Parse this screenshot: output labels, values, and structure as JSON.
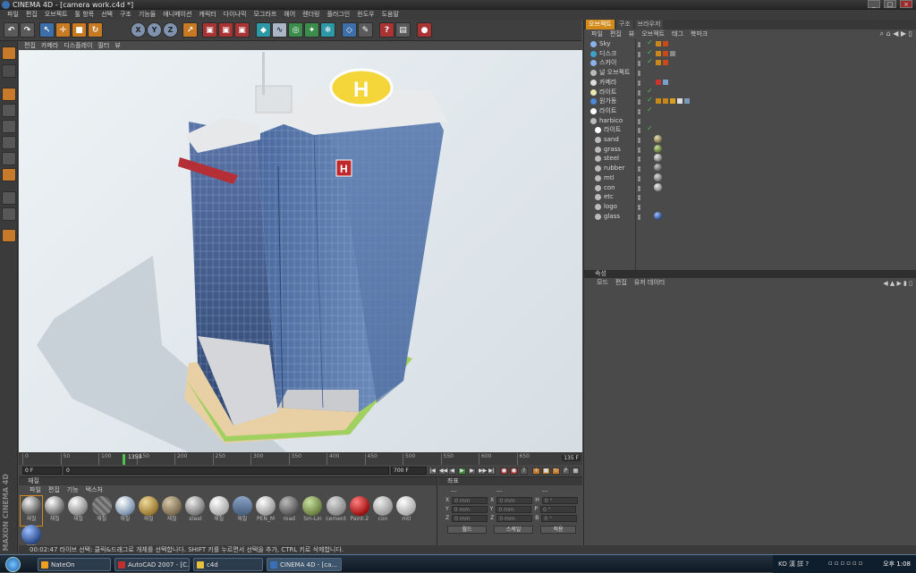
{
  "window": {
    "title": "CINEMA 4D - [camera work.c4d *]",
    "controls": [
      "_",
      "□",
      "×"
    ]
  },
  "menubar": [
    "파일",
    "편집",
    "오브젝트",
    "툴 항목",
    "선택",
    "구조",
    "기능들",
    "애니메이션",
    "캐릭터",
    "다이나믹",
    "모그라프",
    "헤어",
    "렌더링",
    "플러그인",
    "윈도우",
    "도움말"
  ],
  "toolbar": {
    "tools": [
      {
        "name": "undo",
        "glyph": "↶",
        "tone": ""
      },
      {
        "name": "redo",
        "glyph": "↷",
        "tone": ""
      },
      {
        "name": "live-select",
        "glyph": "↖",
        "tone": "b"
      },
      {
        "name": "move",
        "glyph": "✛",
        "tone": "o"
      },
      {
        "name": "scale",
        "glyph": "■",
        "tone": "o"
      },
      {
        "name": "rotate",
        "glyph": "↻",
        "tone": "o"
      },
      {
        "name": "x-axis",
        "glyph": "X",
        "tone": "ring"
      },
      {
        "name": "y-axis",
        "glyph": "Y",
        "tone": "ring"
      },
      {
        "name": "z-axis",
        "glyph": "Z",
        "tone": "ring"
      },
      {
        "name": "coord-system",
        "glyph": "↗",
        "tone": "o"
      },
      {
        "name": "render-view",
        "glyph": "▣",
        "tone": "r"
      },
      {
        "name": "render-picture-viewer",
        "glyph": "▣",
        "tone": "r"
      },
      {
        "name": "render-settings",
        "glyph": "▣",
        "tone": "r"
      },
      {
        "name": "cube",
        "glyph": "◆",
        "tone": "c"
      },
      {
        "name": "spline",
        "glyph": "∿",
        "tone": "l"
      },
      {
        "name": "nurbs",
        "glyph": "◎",
        "tone": "g"
      },
      {
        "name": "array",
        "glyph": "✦",
        "tone": "g"
      },
      {
        "name": "deformer",
        "glyph": "❄",
        "tone": "c"
      },
      {
        "name": "scene",
        "glyph": "◇",
        "tone": "b"
      },
      {
        "name": "camera",
        "glyph": "✎",
        "tone": ""
      },
      {
        "name": "light",
        "glyph": "?",
        "tone": "r"
      },
      {
        "name": "render-region",
        "glyph": "▤",
        "tone": ""
      },
      {
        "name": "record",
        "glyph": "●",
        "tone": "r"
      }
    ]
  },
  "viewport": {
    "menu": [
      "편집",
      "카메라",
      "디스플레이",
      "필터",
      "뷰"
    ],
    "sign_letter": "H"
  },
  "timeline": {
    "ticks": [
      "0",
      "50",
      "100",
      "150",
      "200",
      "250",
      "300",
      "350",
      "400",
      "450",
      "500",
      "550",
      "600",
      "650"
    ],
    "playhead_label": "1350",
    "end_frame": "135 F"
  },
  "transport": {
    "start": "0 F",
    "current": "0",
    "end": "700 F"
  },
  "materials": {
    "title": "재질",
    "menu": [
      "파일",
      "편집",
      "기능",
      "텍스처"
    ],
    "items": [
      {
        "label": "재질",
        "color": "radial-gradient(circle at 35% 30%,#f0f0f0,#555 70%,#222)",
        "selected": true
      },
      {
        "label": "재질",
        "color": "radial-gradient(circle at 35% 30%,#fff,#666 70%,#333)"
      },
      {
        "label": "재질",
        "color": "radial-gradient(circle at 35% 30%,#fff,#888 70%,#444)"
      },
      {
        "label": "재질",
        "color": "repeating-linear-gradient(45deg,#666 0 3px,#888 3px 6px)"
      },
      {
        "label": "재질",
        "color": "radial-gradient(circle at 35% 30%,#fff,#8aa0b8 60%,#3b4e66)"
      },
      {
        "label": "재질",
        "color": "radial-gradient(circle at 35% 30%,#f0d89a,#9a7a30 70%,#4a3810)"
      },
      {
        "label": "재질",
        "color": "radial-gradient(circle at 35% 30%,#d8c8a8,#7a6a50 70%,#3a3020)"
      },
      {
        "label": "steel",
        "color": "radial-gradient(circle at 35% 30%,#eee,#777 70%,#333)"
      },
      {
        "label": "재질",
        "color": "radial-gradient(circle at 35% 30%,#fff,#aaa 70%,#555)"
      },
      {
        "label": "재질",
        "color": "linear-gradient(#8aa4c8,#445a7a)"
      },
      {
        "label": "PEN_M",
        "color": "radial-gradient(circle at 35% 30%,#fff,#999 70%,#444)"
      },
      {
        "label": "road",
        "color": "radial-gradient(circle at 35% 30%,#bbb,#555 70%,#222)"
      },
      {
        "label": "Sm-Lin",
        "color": "radial-gradient(circle at 35% 30%,#c8e0a0,#6a8040 70%,#2a3a10)"
      },
      {
        "label": "cement",
        "color": "radial-gradient(circle at 35% 30%,#ddd,#888 70%,#444)"
      },
      {
        "label": "Paint-2",
        "color": "radial-gradient(circle at 35% 30%,#ff8080,#a01010 70%,#400)"
      },
      {
        "label": "con",
        "color": "radial-gradient(circle at 35% 30%,#eee,#999 70%,#555)"
      },
      {
        "label": "mtl",
        "color": "radial-gradient(circle at 35% 30%,#fff,#aaa 70%,#555)"
      },
      {
        "label": "재질",
        "color": "radial-gradient(circle at 35% 30%,#9ec0ff,#2a4a8a 70%,#0a1a3a)"
      }
    ]
  },
  "coords": {
    "title": "좌표",
    "pos_header": "---",
    "size_header": "---",
    "rot_header": "---",
    "rows": [
      {
        "axis": "X",
        "pos": "0 mm",
        "size": "0 mm",
        "rlabel": "H",
        "rot": "0 °"
      },
      {
        "axis": "Y",
        "pos": "0 mm",
        "size": "0 mm",
        "rlabel": "P",
        "rot": "0 °"
      },
      {
        "axis": "Z",
        "pos": "0 mm",
        "size": "0 mm",
        "rlabel": "B",
        "rot": "0 °"
      }
    ],
    "mode1": "월드",
    "mode2": "스케일",
    "apply": "적용"
  },
  "objects": {
    "tabs": [
      {
        "label": "오브젝트",
        "active": true
      },
      {
        "label": "구조",
        "active": false
      },
      {
        "label": "브라우저",
        "active": false
      }
    ],
    "menu": [
      "파일",
      "편집",
      "뷰",
      "오브젝트",
      "태그",
      "북마크"
    ],
    "rows": [
      {
        "name": "Sky",
        "icon": "#8ab4e8",
        "indent": 0,
        "check": true,
        "tags": [
          "#c8891a",
          "#c84a1a"
        ]
      },
      {
        "name": "디스크",
        "icon": "#3fa0c8",
        "indent": 0,
        "check": true,
        "tags": [
          "#c8891a",
          "#c84a1a",
          "#888"
        ]
      },
      {
        "name": "스카이",
        "icon": "#8ab4e8",
        "indent": 0,
        "check": true,
        "tags": [
          "#c8891a",
          "#c84a1a"
        ]
      },
      {
        "name": "널 오브젝트",
        "icon": "#bbbbbb",
        "indent": 0,
        "check": false,
        "tags": []
      },
      {
        "name": "카메라",
        "icon": "#dddddd",
        "indent": 0,
        "check": false,
        "tags": [
          "#cc3333",
          "#7aa0c8"
        ]
      },
      {
        "name": "라이트",
        "icon": "#e8e8b0",
        "indent": 0,
        "check": true,
        "tags": []
      },
      {
        "name": "원가동",
        "icon": "#4a8ad8",
        "indent": 0,
        "check": true,
        "tags": [
          "#c8891a",
          "#c8891a",
          "#d8a020",
          "#ddd",
          "#7a9ab8"
        ]
      },
      {
        "name": "라이트",
        "icon": "#ffffff",
        "indent": 0,
        "check": true,
        "tags": []
      },
      {
        "name": "harbico",
        "icon": "#bbbbbb",
        "indent": 0,
        "check": false,
        "tags": []
      },
      {
        "name": "라이트",
        "icon": "#ffffff",
        "indent": 1,
        "check": true,
        "tags": []
      },
      {
        "name": "sand",
        "icon": "#bbbbbb",
        "indent": 1,
        "check": false,
        "tags": [],
        "sphere": "radial-gradient(circle at 35% 30%,#e8e0c0,#7a7040 70%,#333)"
      },
      {
        "name": "grass",
        "icon": "#bbbbbb",
        "indent": 1,
        "check": false,
        "tags": [],
        "sphere": "radial-gradient(circle at 35% 30%,#c8e0a0,#5a7030 70%,#222)"
      },
      {
        "name": "steel",
        "icon": "#bbbbbb",
        "indent": 1,
        "check": false,
        "tags": [],
        "sphere": "radial-gradient(circle at 35% 30%,#eee,#777 70%,#222)"
      },
      {
        "name": "rubber",
        "icon": "#bbbbbb",
        "indent": 1,
        "check": false,
        "tags": [],
        "sphere": "radial-gradient(circle at 35% 30%,#ccc,#555 70%,#111)"
      },
      {
        "name": "mtl",
        "icon": "#bbbbbb",
        "indent": 1,
        "check": false,
        "tags": [],
        "sphere": "radial-gradient(circle at 35% 30%,#ddd,#777 70%,#222)"
      },
      {
        "name": "con",
        "icon": "#bbbbbb",
        "indent": 1,
        "check": false,
        "tags": [],
        "sphere": "radial-gradient(circle at 35% 30%,#eee,#888 70%,#333)"
      },
      {
        "name": "etc",
        "icon": "#bbbbbb",
        "indent": 1,
        "check": false,
        "tags": []
      },
      {
        "name": "logo",
        "icon": "#bbbbbb",
        "indent": 1,
        "check": false,
        "tags": []
      },
      {
        "name": "glass",
        "icon": "#bbbbbb",
        "indent": 1,
        "check": false,
        "tags": [],
        "sphere": "radial-gradient(circle at 35% 30%,#9ec0ff,#2a4a8a 70%,#0a1a3a)"
      }
    ]
  },
  "attributes": {
    "title": "속성",
    "menu": [
      "모드",
      "편집",
      "유저 데이터"
    ]
  },
  "statusbar": "00:02:47  라이브 선택: 클릭&드래그로 개체를 선택합니다. SHIFT 키를 누르면서 선택을 추가, CTRL 키로 삭제합니다.",
  "taskbar": {
    "tasks": [
      {
        "label": "NateOn",
        "color": "#f0a020",
        "active": false
      },
      {
        "label": "AutoCAD 2007 - [C...",
        "color": "#c03030",
        "active": false
      },
      {
        "label": "c4d",
        "color": "#e8c040",
        "active": false
      },
      {
        "label": "CINEMA 4D - [ca...",
        "color": "#3a70b8",
        "active": true
      }
    ],
    "tray_text": "KO 漢 詳 ?",
    "clock": "오후 1:08"
  }
}
